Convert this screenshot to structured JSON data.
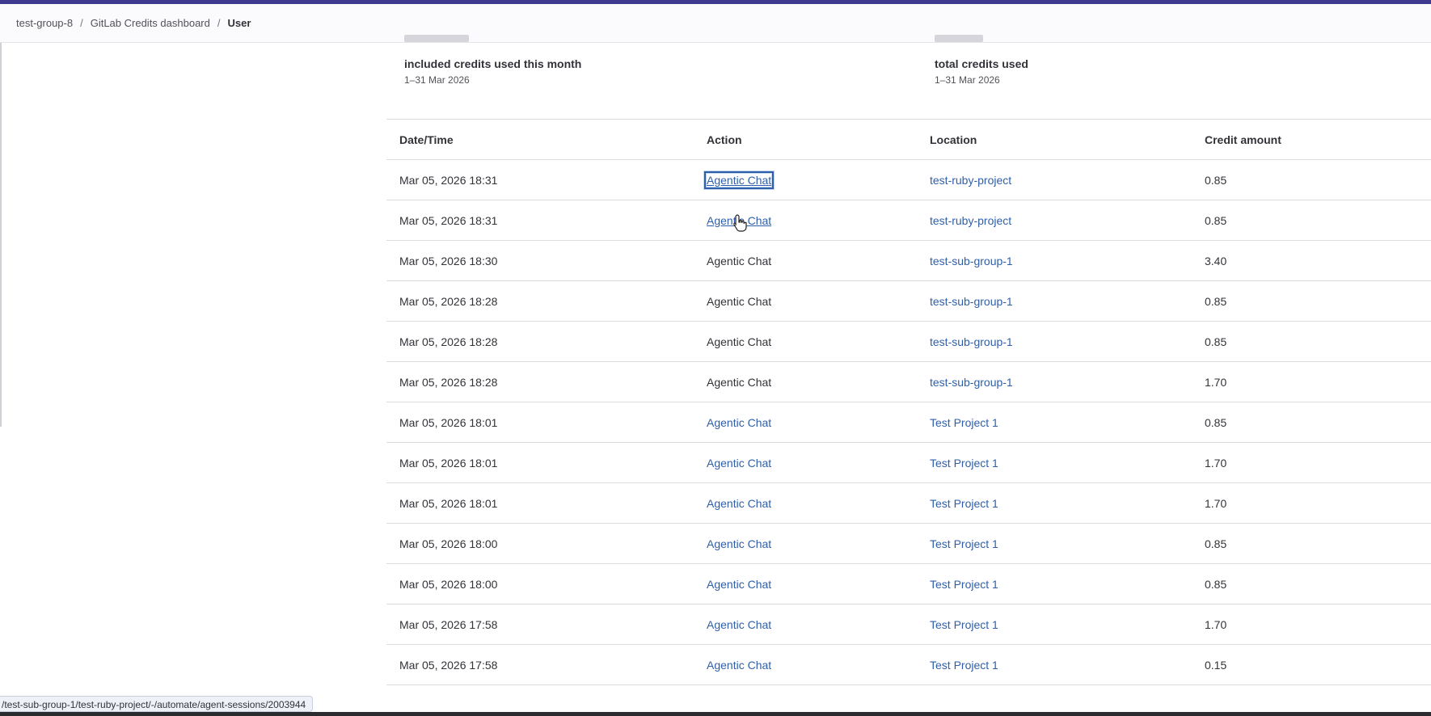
{
  "breadcrumb": {
    "items": [
      "test-group-8",
      "GitLab Credits dashboard",
      "User"
    ],
    "separator": "/"
  },
  "summary": {
    "included": {
      "label": "included credits used this month",
      "period": "1–31 Mar 2026"
    },
    "total": {
      "label": "total credits used",
      "period": "1–31 Mar 2026"
    }
  },
  "table": {
    "headers": {
      "date": "Date/Time",
      "action": "Action",
      "location": "Location",
      "credit": "Credit amount"
    },
    "rows": [
      {
        "date": "Mar 05, 2026 18:31",
        "action": "Agentic Chat",
        "location": "test-ruby-project",
        "credit": "0.85"
      },
      {
        "date": "Mar 05, 2026 18:31",
        "action": "Agentic Chat",
        "location": "test-ruby-project",
        "credit": "0.85"
      },
      {
        "date": "Mar 05, 2026 18:30",
        "action": "Agentic Chat",
        "location": "test-sub-group-1",
        "credit": "3.40"
      },
      {
        "date": "Mar 05, 2026 18:28",
        "action": "Agentic Chat",
        "location": "test-sub-group-1",
        "credit": "0.85"
      },
      {
        "date": "Mar 05, 2026 18:28",
        "action": "Agentic Chat",
        "location": "test-sub-group-1",
        "credit": "0.85"
      },
      {
        "date": "Mar 05, 2026 18:28",
        "action": "Agentic Chat",
        "location": "test-sub-group-1",
        "credit": "1.70"
      },
      {
        "date": "Mar 05, 2026 18:01",
        "action": "Agentic Chat",
        "location": "Test Project 1",
        "credit": "0.85"
      },
      {
        "date": "Mar 05, 2026 18:01",
        "action": "Agentic Chat",
        "location": "Test Project 1",
        "credit": "1.70"
      },
      {
        "date": "Mar 05, 2026 18:01",
        "action": "Agentic Chat",
        "location": "Test Project 1",
        "credit": "1.70"
      },
      {
        "date": "Mar 05, 2026 18:00",
        "action": "Agentic Chat",
        "location": "Test Project 1",
        "credit": "0.85"
      },
      {
        "date": "Mar 05, 2026 18:00",
        "action": "Agentic Chat",
        "location": "Test Project 1",
        "credit": "0.85"
      },
      {
        "date": "Mar 05, 2026 17:58",
        "action": "Agentic Chat",
        "location": "Test Project 1",
        "credit": "1.70"
      },
      {
        "date": "Mar 05, 2026 17:58",
        "action": "Agentic Chat",
        "location": "Test Project 1",
        "credit": "0.15"
      }
    ]
  },
  "status_url": "/test-sub-group-1/test-ruby-project/-/automate/agent-sessions/2003944",
  "colors": {
    "accent": "#3d3a8f",
    "link": "#2f5fa8"
  }
}
